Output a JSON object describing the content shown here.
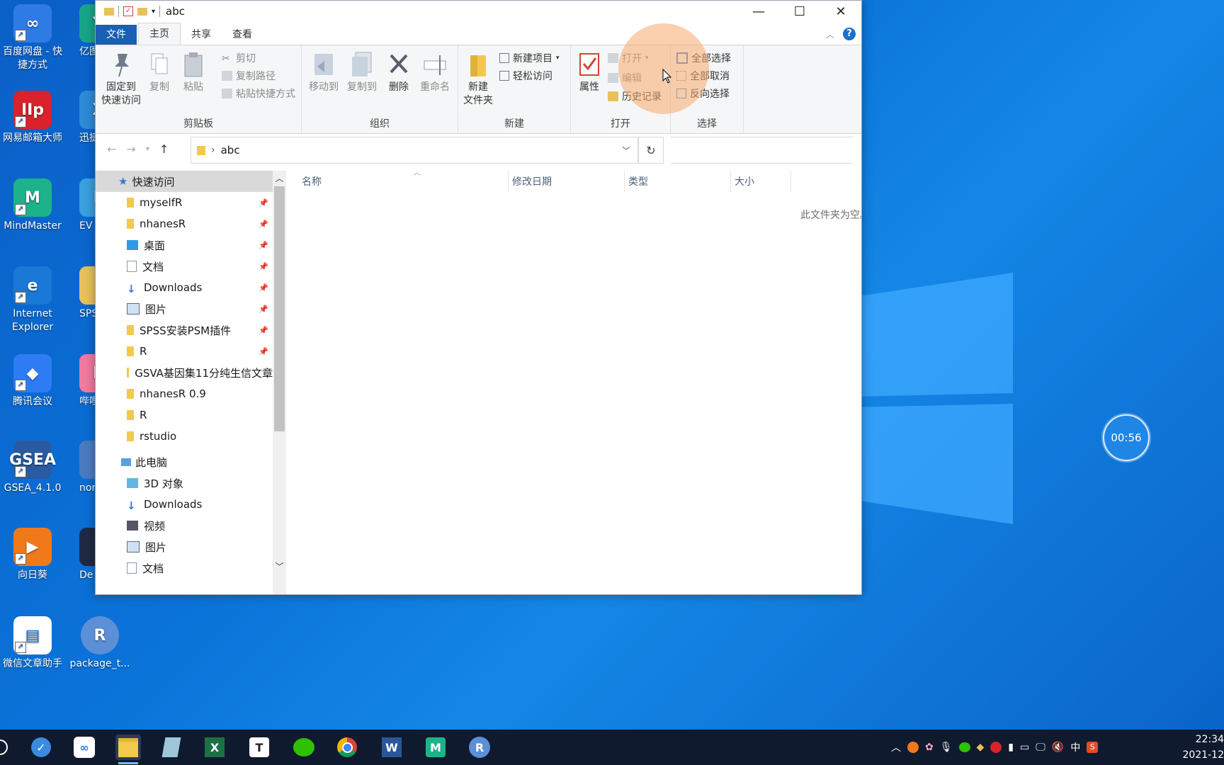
{
  "desktop": {
    "icons": [
      {
        "label": "百度网盘 - 快捷方式",
        "color": "#2e7be6",
        "glyph": "∞"
      },
      {
        "label": "网易邮箱大师",
        "color": "#d9222a",
        "glyph": "IIp"
      },
      {
        "label": "MindMaster",
        "color": "#1db38a",
        "glyph": "M"
      },
      {
        "label": "Internet Explorer",
        "color": "#1a78d6",
        "glyph": "e"
      },
      {
        "label": "腾讯会议",
        "color": "#2d7cf6",
        "glyph": "◆"
      },
      {
        "label": "GSEA_4.1.0",
        "color": "#2a5aa0",
        "glyph": "GSEA"
      },
      {
        "label": "向日葵",
        "color": "#f07a1a",
        "glyph": "▶"
      },
      {
        "label": "微信文章助手",
        "color": "#ffffff",
        "glyph": "▤"
      }
    ],
    "icons_col2": [
      {
        "label": "亿图 Mind",
        "color": "#17a589",
        "glyph": "Y"
      },
      {
        "label": "迅捷P",
        "color": "#2f8ad8",
        "glyph": "X"
      },
      {
        "label": "EV",
        "color": "#3aa0e0",
        "glyph": "E"
      },
      {
        "label": "SPSS PSM",
        "color": "#e8c15a",
        "glyph": ""
      },
      {
        "label": "哔哩哔",
        "color": "#f27aa0",
        "glyph": "b"
      },
      {
        "label": "norm",
        "color": "#4a7cc1",
        "glyph": ""
      },
      {
        "label": "De",
        "color": "#1e2a44",
        "glyph": ""
      },
      {
        "label": "package_t...",
        "color": "#5b8fd6",
        "glyph": "R"
      }
    ],
    "timer": "00:56"
  },
  "window": {
    "title": "abc",
    "tabs": [
      "文件",
      "主页",
      "共享",
      "查看"
    ],
    "ribbon": {
      "clipboard": {
        "label": "剪贴板",
        "pin": "固定到\n快速访问",
        "copy": "复制",
        "paste": "粘贴",
        "cut": "剪切",
        "copy_path": "复制路径",
        "paste_shortcut": "粘贴快捷方式"
      },
      "organize": {
        "label": "组织",
        "move_to": "移动到",
        "copy_to": "复制到",
        "delete": "删除",
        "rename": "重命名"
      },
      "new": {
        "label": "新建",
        "new_folder": "新建\n文件夹",
        "new_item": "新建项目",
        "easy_access": "轻松访问"
      },
      "open": {
        "label": "打开",
        "properties": "属性",
        "open": "打开",
        "edit": "编辑",
        "history": "历史记录"
      },
      "select": {
        "label": "选择",
        "select_all": "全部选择",
        "select_none": "全部取消",
        "invert": "反向选择"
      }
    },
    "address": {
      "path": "abc"
    },
    "nav_pane": {
      "quick_access": "快速访问",
      "items": [
        {
          "label": "myselfR",
          "icon": "folder-icon",
          "pinned": true
        },
        {
          "label": "nhanesR",
          "icon": "folder-icon",
          "pinned": true
        },
        {
          "label": "桌面",
          "icon": "desktop-icon",
          "pinned": true
        },
        {
          "label": "文档",
          "icon": "document-icon",
          "pinned": true
        },
        {
          "label": "Downloads",
          "icon": "download-icon",
          "pinned": true
        },
        {
          "label": "图片",
          "icon": "picture-icon",
          "pinned": true
        },
        {
          "label": "SPSS安装PSM插件",
          "icon": "folder-icon",
          "pinned": true
        },
        {
          "label": "R",
          "icon": "folder-icon",
          "pinned": true
        },
        {
          "label": "GSVA基因集11分纯生信文章",
          "icon": "folder-icon",
          "pinned": false
        },
        {
          "label": "nhanesR 0.9",
          "icon": "folder-icon",
          "pinned": false
        },
        {
          "label": "R",
          "icon": "folder-icon",
          "pinned": false
        },
        {
          "label": "rstudio",
          "icon": "folder-icon",
          "pinned": false
        }
      ],
      "this_pc": "此电脑",
      "pc_items": [
        {
          "label": "3D 对象",
          "icon": "cube-icon"
        },
        {
          "label": "Downloads",
          "icon": "download-icon"
        },
        {
          "label": "视频",
          "icon": "video-icon"
        },
        {
          "label": "图片",
          "icon": "picture-icon"
        },
        {
          "label": "文档",
          "icon": "document-icon"
        }
      ]
    },
    "columns": [
      "名称",
      "修改日期",
      "类型",
      "大小"
    ],
    "empty_message": "此文件夹为空。"
  },
  "taskbar": {
    "apps": [
      "start",
      "vpn-icon",
      "baidu-netdisk-icon",
      "file-explorer-icon",
      "notepad-icon",
      "excel-icon",
      "typora-icon",
      "wechat-icon",
      "chrome-icon",
      "word-icon",
      "mindmaster-icon",
      "r-icon"
    ],
    "tray": {
      "ime": "中"
    },
    "clock_time": "22:34",
    "clock_date": "2021-12"
  },
  "colors": {
    "accent": "#1a5fb4",
    "highlight": "#f8aa6e"
  }
}
